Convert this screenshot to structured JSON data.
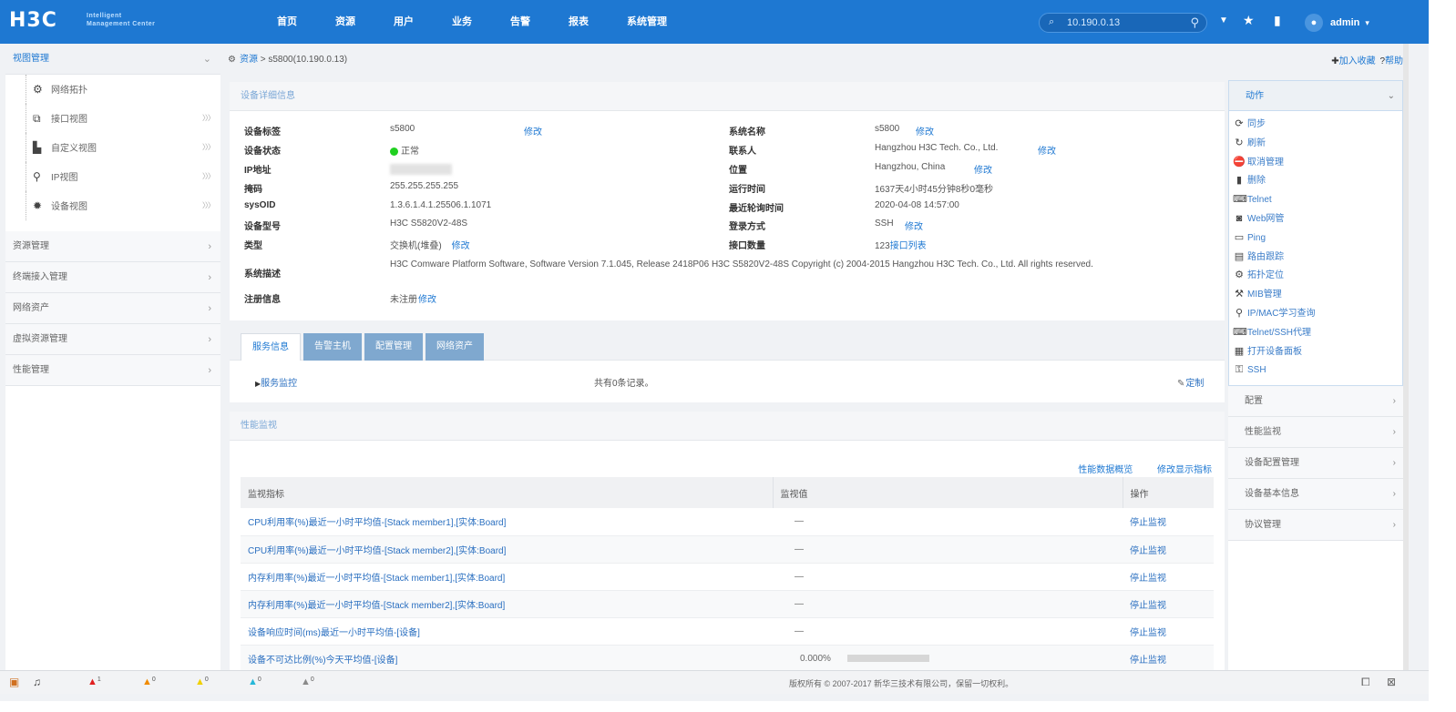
{
  "header": {
    "logo": "H3C",
    "logo_sub_1": "Intelligent",
    "logo_sub_2": "Management Center",
    "nav": [
      "首页",
      "资源",
      "用户",
      "业务",
      "告警",
      "报表",
      "系统管理"
    ],
    "search_value": "10.190.0.13",
    "user": "admin"
  },
  "sidebar": {
    "groups": [
      {
        "label": "视图管理",
        "open": true,
        "items": [
          {
            "label": "网络拓扑",
            "icon": "gear-icon",
            "more": false
          },
          {
            "label": "接口视图",
            "icon": "interface-icon",
            "more": true
          },
          {
            "label": "自定义视图",
            "icon": "custom-view-icon",
            "more": true
          },
          {
            "label": "IP视图",
            "icon": "ip-view-icon",
            "more": true
          },
          {
            "label": "设备视图",
            "icon": "device-view-icon",
            "more": true
          }
        ]
      },
      {
        "label": "资源管理"
      },
      {
        "label": "终端接入管理"
      },
      {
        "label": "网络资产"
      },
      {
        "label": "虚拟资源管理"
      },
      {
        "label": "性能管理"
      }
    ]
  },
  "breadcrumb": {
    "root": "资源",
    "sep": " > ",
    "current": "s5800(10.190.0.13)"
  },
  "top_actions": {
    "favorite": "加入收藏",
    "help": "帮助"
  },
  "detail": {
    "title": "设备详细信息",
    "edit_label": "修改",
    "left": [
      {
        "label": "设备标签",
        "value": "s5800",
        "editable": true
      },
      {
        "label": "设备状态",
        "value": "正常",
        "status": true
      },
      {
        "label": "IP地址",
        "value": ""
      },
      {
        "label": "掩码",
        "value": "255.255.255.255"
      },
      {
        "label": "sysOID",
        "value": "1.3.6.1.4.1.25506.1.1071"
      },
      {
        "label": "设备型号",
        "value": "H3C S5820V2-48S"
      },
      {
        "label": "类型",
        "value": "交换机(堆叠)",
        "editable": true
      }
    ],
    "right": [
      {
        "label": "系统名称",
        "value": "s5800",
        "editable": true
      },
      {
        "label": "联系人",
        "value": "Hangzhou H3C Tech. Co., Ltd.",
        "editable": true
      },
      {
        "label": "位置",
        "value": "Hangzhou, China",
        "editable": true
      },
      {
        "label": "运行时间",
        "value": "1637天4小时45分钟8秒0毫秒"
      },
      {
        "label": "最近轮询时间",
        "value": "2020-04-08 14:57:00"
      },
      {
        "label": "登录方式",
        "value": "SSH",
        "editable": true
      },
      {
        "label": "接口数量",
        "value": "123",
        "link": "接口列表"
      }
    ],
    "sys_desc_label": "系统描述",
    "sys_desc": "H3C Comware Platform Software, Software Version 7.1.045, Release 2418P06 H3C S5820V2-48S Copyright (c) 2004-2015 Hangzhou H3C Tech. Co., Ltd. All rights reserved.",
    "register_label": "注册信息",
    "register_value": "未注册"
  },
  "tabs": {
    "items": [
      "服务信息",
      "告警主机",
      "配置管理",
      "网络资产"
    ],
    "active": 0,
    "service_link": "服务监控",
    "empty_text": "共有0条记录。",
    "customize": "定制"
  },
  "perf": {
    "title": "性能监视",
    "links": [
      "性能数据概览",
      "修改显示指标"
    ],
    "columns": [
      "监视指标",
      "监视值",
      "操作"
    ],
    "rows": [
      {
        "metric": "CPU利用率(%)最近一小时平均值-[Stack member1],[实体:Board]",
        "value": "—",
        "action": "停止监视"
      },
      {
        "metric": "CPU利用率(%)最近一小时平均值-[Stack member2],[实体:Board]",
        "value": "—",
        "action": "停止监视"
      },
      {
        "metric": "内存利用率(%)最近一小时平均值-[Stack member1],[实体:Board]",
        "value": "—",
        "action": "停止监视"
      },
      {
        "metric": "内存利用率(%)最近一小时平均值-[Stack member2],[实体:Board]",
        "value": "—",
        "action": "停止监视"
      },
      {
        "metric": "设备响应时间(ms)最近一小时平均值-[设备]",
        "value": "—",
        "action": "停止监视"
      },
      {
        "metric": "设备不可达比例(%)今天平均值-[设备]",
        "value": "0.000%",
        "bar": true,
        "action": "停止监视"
      }
    ]
  },
  "right_panel": {
    "title": "动作",
    "actions": [
      {
        "label": "同步",
        "icon": "sync-icon"
      },
      {
        "label": "刷新",
        "icon": "refresh-icon"
      },
      {
        "label": "取消管理",
        "icon": "unmanage-icon"
      },
      {
        "label": "删除",
        "icon": "delete-icon"
      },
      {
        "label": "Telnet",
        "icon": "telnet-icon"
      },
      {
        "label": "Web网管",
        "icon": "web-icon"
      },
      {
        "label": "Ping",
        "icon": "ping-icon"
      },
      {
        "label": "路由跟踪",
        "icon": "traceroute-icon"
      },
      {
        "label": "拓扑定位",
        "icon": "topology-icon"
      },
      {
        "label": "MIB管理",
        "icon": "mib-icon"
      },
      {
        "label": "IP/MAC学习查询",
        "icon": "ip-mac-icon"
      },
      {
        "label": "Telnet/SSH代理",
        "icon": "proxy-icon"
      },
      {
        "label": "打开设备面板",
        "icon": "panel-icon"
      },
      {
        "label": "SSH",
        "icon": "ssh-icon"
      }
    ],
    "groups": [
      "配置",
      "性能监视",
      "设备配置管理",
      "设备基本信息",
      "协议管理"
    ]
  },
  "statusbar": {
    "alarms": [
      {
        "count": "1",
        "color": "#e02020"
      },
      {
        "count": "0",
        "color": "#f08a00"
      },
      {
        "count": "0",
        "color": "#f0d000"
      },
      {
        "count": "0",
        "color": "#26b7d8"
      },
      {
        "count": "0",
        "color": "#8a8a8a"
      }
    ],
    "copyright": "版权所有 © 2007-2017 新华三技术有限公司，保留一切权利。"
  }
}
